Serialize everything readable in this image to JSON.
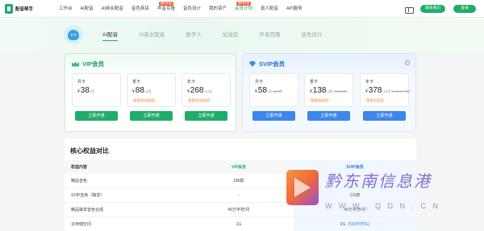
{
  "app": {
    "name": "配音帮手"
  },
  "nav": {
    "items": [
      {
        "label": "工作台",
        "badge": ""
      },
      {
        "label": "AI配音",
        "badge": ""
      },
      {
        "label": "AI商业配音",
        "badge": ""
      },
      {
        "label": "音色商店",
        "badge": ""
      },
      {
        "label": "声音克隆",
        "badge": "限时优惠"
      },
      {
        "label": "音色设计",
        "badge": ""
      },
      {
        "label": "我的资产",
        "badge": ""
      },
      {
        "label": "会员计划",
        "badge": "限时优惠"
      },
      {
        "label": "真人配音",
        "badge": ""
      },
      {
        "label": "API服务",
        "badge": ""
      }
    ],
    "active_index": 7,
    "gift_icon": "gift-icon",
    "contact_label": "联系我们",
    "login_label": "登录"
  },
  "hero": {
    "tabs": [
      "AI配音",
      "AI商业配音",
      "数字人",
      "加油包",
      "声音克隆",
      "音色设计"
    ],
    "active_index": 0
  },
  "vip": {
    "title": "VIP会员",
    "icon": "crown-icon",
    "plans": [
      {
        "name": "月卡",
        "currency": "¥",
        "price": "38",
        "unit": "/月",
        "original": "",
        "tag": ""
      },
      {
        "name": "季卡",
        "currency": "¥",
        "price": "88",
        "unit": "/3月",
        "original": "",
        "tag": "折合29.33元/月"
      },
      {
        "name": "年卡",
        "currency": "¥",
        "price": "268",
        "unit": "/12月",
        "original": "",
        "tag": "折合22.33元/月"
      }
    ],
    "buy_label": "立即开通",
    "color": "#1fae6a"
  },
  "svip": {
    "title": "SVIP会员",
    "icon": "diamond-icon",
    "plans": [
      {
        "name": "月卡",
        "currency": "¥",
        "price": "58",
        "unit": "/月",
        "original": "¥68/月",
        "tag": ""
      },
      {
        "name": "季卡",
        "currency": "¥",
        "price": "138",
        "unit": "/3月",
        "original": "¥168/3月",
        "tag": "折合46元/月"
      },
      {
        "name": "年卡",
        "currency": "¥",
        "price": "378",
        "unit": "/12月",
        "original": "¥468/12+2月",
        "tag": "折合27元/月"
      }
    ],
    "buy_label": "立即开通",
    "color": "#3d86ec"
  },
  "compare": {
    "title": "核心权益对比",
    "headers": [
      "权益内容",
      "VIP会员",
      "SVIP会员"
    ],
    "rows": [
      {
        "name": "精品音色",
        "vip": "186款",
        "svip": "",
        "note": ""
      },
      {
        "name": "SVIP音色（臻享）",
        "vip": "-",
        "svip": "115款",
        "note": ""
      },
      {
        "name": "精品臻享音色合成",
        "vip": "40万字符/月",
        "svip": "40万字符/月",
        "note": ""
      },
      {
        "name": "云存储空间",
        "vip": "1G",
        "svip": "2G",
        "note": "(500字符/G)"
      }
    ]
  },
  "watermark": {
    "chinese": "黔东南信息港",
    "url": "W W W . Q D N . C N"
  }
}
